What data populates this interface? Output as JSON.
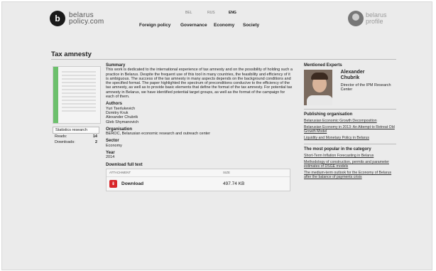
{
  "header": {
    "logo_line1": "belarus",
    "logo_line2": "policy.com",
    "logo_mark": "b",
    "languages": [
      "BEL",
      "RUS",
      "ENG"
    ],
    "active_language": "ENG",
    "nav": [
      "Foreign policy",
      "Governance",
      "Economy",
      "Society"
    ],
    "profile_line1": "belarus",
    "profile_line2": "profile"
  },
  "page_title": "Tax amnesty",
  "statistics": {
    "heading": "Statistics research",
    "reads_label": "Reads:",
    "reads_value": "14",
    "downloads_label": "Downloads:",
    "downloads_value": "2"
  },
  "summary": {
    "heading": "Summary",
    "text": "This work is dedicated to the international experience of tax amnesty and on the possibility of holding such a practice in Belarus. Despite the frequent use of this tool in many countries, the feasibility and efficiency of it is ambiguous. The success of the tax amnesty in many aspects depends on the background conditions and the specified format. The paper highlighted the spectrum of preconditions conducive to the efficiency of the tax amnesty, as well as to provide basic elements that define the format of the tax amnesty. For potential tax amnesty in Belarus, we have identified potential target groups, as well as the format of the campaign for each of them."
  },
  "authors": {
    "heading": "Authors",
    "list": [
      "Yuri Tserlukevich",
      "Dzmitry Kruk",
      "Alexander Chubrik",
      "Gleb Shymanovich"
    ]
  },
  "organisation": {
    "heading": "Organisation",
    "value": "BEROC, Belarusian economic research and outreach center"
  },
  "sector": {
    "heading": "Sector",
    "value": "Economy"
  },
  "year": {
    "heading": "Year",
    "value": "2014"
  },
  "download": {
    "heading": "Download full text",
    "col_attachment": "ATTACHMENT",
    "col_size": "SIZE",
    "link_label": "Download",
    "size": "497.74 KB"
  },
  "mentioned_experts": {
    "heading": "Mentioned Experts",
    "name_line1": "Alexander",
    "name_line2": "Chubrik",
    "position": "Director of the IPM Research Center"
  },
  "publishing_org": {
    "heading": "Publishing organisation",
    "links": [
      "Belarusian Economic Growth Decomposition",
      "Belarusian Economy in 2013: An Attempt to Retreat Old Growth Model",
      "Liquidity and Monetary Policy in Belarus"
    ]
  },
  "most_popular": {
    "heading": "The most popular in the category",
    "links": [
      "Short-Term Inflation Forecasting in Belarus",
      "Methodology of construction, permits and parameter estimates of DSGE models",
      "The medium-term outlook for the Economy of Belarus after the balance of payments crisis"
    ]
  }
}
